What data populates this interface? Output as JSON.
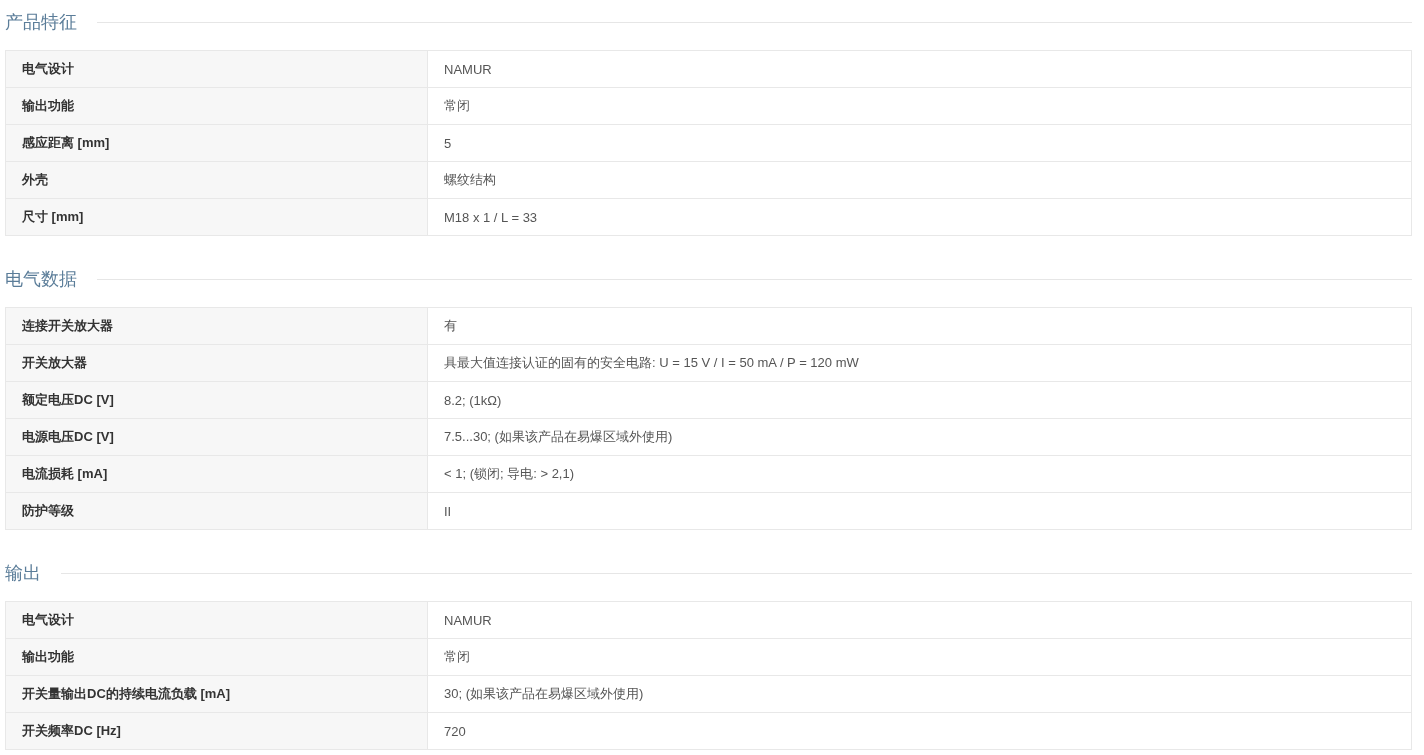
{
  "sections": [
    {
      "title": "产品特征",
      "rows": [
        {
          "label": "电气设计",
          "value": "NAMUR"
        },
        {
          "label": "输出功能",
          "value": "常闭"
        },
        {
          "label": "感应距离 [mm]",
          "value": "5"
        },
        {
          "label": "外壳",
          "value": "螺纹结构"
        },
        {
          "label": "尺寸 [mm]",
          "value": "M18 x 1 / L = 33"
        }
      ]
    },
    {
      "title": "电气数据",
      "rows": [
        {
          "label": "连接开关放大器",
          "value": "有"
        },
        {
          "label": "开关放大器",
          "value": "具最大值连接认证的固有的安全电路: U = 15 V / I = 50 mA / P = 120 mW"
        },
        {
          "label": "额定电压DC [V]",
          "value": "8.2; (1kΩ)"
        },
        {
          "label": "电源电压DC [V]",
          "value": "7.5...30; (如果该产品在易爆区域外使用)"
        },
        {
          "label": "电流损耗 [mA]",
          "value": "< 1; (锁闭; 导电: > 2,1)"
        },
        {
          "label": "防护等级",
          "value": "II"
        }
      ]
    },
    {
      "title": "输出",
      "rows": [
        {
          "label": "电气设计",
          "value": "NAMUR"
        },
        {
          "label": "输出功能",
          "value": "常闭"
        },
        {
          "label": "开关量输出DC的持续电流负载 [mA]",
          "value": "30; (如果该产品在易爆区域外使用)"
        },
        {
          "label": "开关频率DC [Hz]",
          "value": "720"
        }
      ]
    }
  ]
}
